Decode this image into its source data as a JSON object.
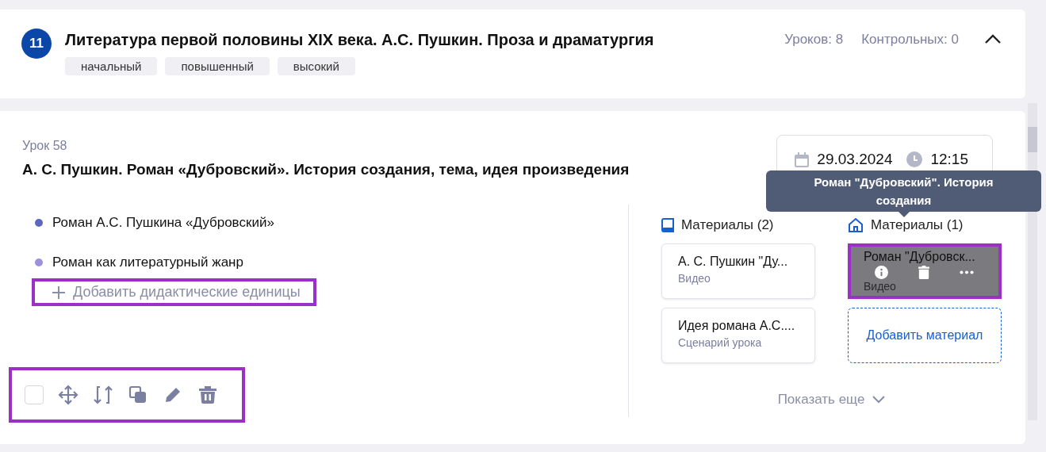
{
  "module": {
    "number": "11",
    "title": "Литература первой половины XIX века. А.С. Пушкин. Проза и драматургия",
    "tags": [
      "начальный",
      "повышенный",
      "высокий"
    ],
    "lessons_count": "Уроков: 8",
    "tests_count": "Контрольных: 0",
    "expanded": true
  },
  "lesson": {
    "label": "Урок 58",
    "title": "А. С. Пушкин. Роман «Дубровский». История создания, тема, идея произведения",
    "date": "29.03.2024",
    "time": "12:15",
    "units": [
      {
        "text": "Роман А.С. Пушкина «Дубровский»",
        "color": "#5b68bd"
      },
      {
        "text": "Роман как литературный жанр",
        "color": "#9a92da"
      }
    ],
    "add_units": {
      "label": "Добавить дидактические единицы",
      "highlighted": true
    },
    "toolbar": {
      "highlighted": true,
      "checked": false
    },
    "materials": [
      {
        "heading": "Материалы (2)",
        "kind": "book",
        "cards": [
          {
            "title": "А. С. Пушкин \"Ду...",
            "type": "Видео",
            "hovered": false,
            "highlighted": false
          },
          {
            "title": "Идея романа А.С....",
            "type": "Сценарий урока",
            "hovered": false,
            "highlighted": false
          }
        ]
      },
      {
        "heading": "Материалы (1)",
        "kind": "home",
        "cards": [
          {
            "title": "Роман \"Дубровск...",
            "type": "Видео",
            "hovered": true,
            "highlighted": true
          }
        ],
        "add_button": "Добавить материал"
      }
    ],
    "show_more": "Показать еще",
    "tooltip": "Роман \"Дубровский\". История создания"
  }
}
